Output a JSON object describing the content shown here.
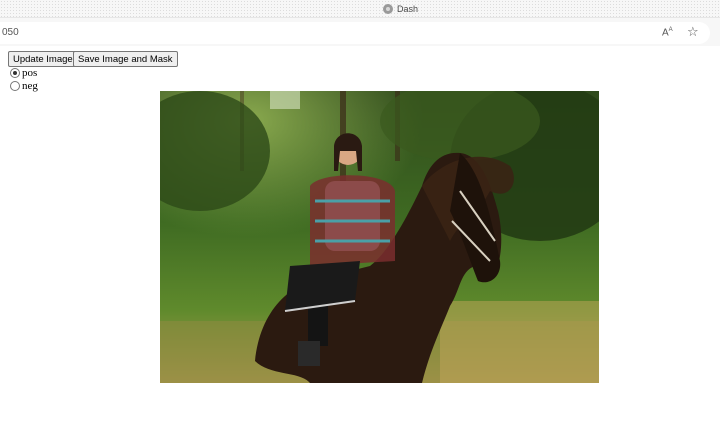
{
  "browser": {
    "tab_title": "Dash",
    "url_partial": "050",
    "reader_label": "A",
    "reader_sup": "A",
    "favicon_icon": "dash-favicon-icon",
    "bookmark_icon": "star-icon"
  },
  "toolbar": {
    "update_label": "Update Image",
    "save_label": "Save Image and Mask"
  },
  "label_mode": {
    "options": [
      {
        "label": "pos",
        "selected": true
      },
      {
        "label": "neg",
        "selected": false
      }
    ]
  },
  "image": {
    "subject_icon": "photo-woman-on-horse"
  }
}
